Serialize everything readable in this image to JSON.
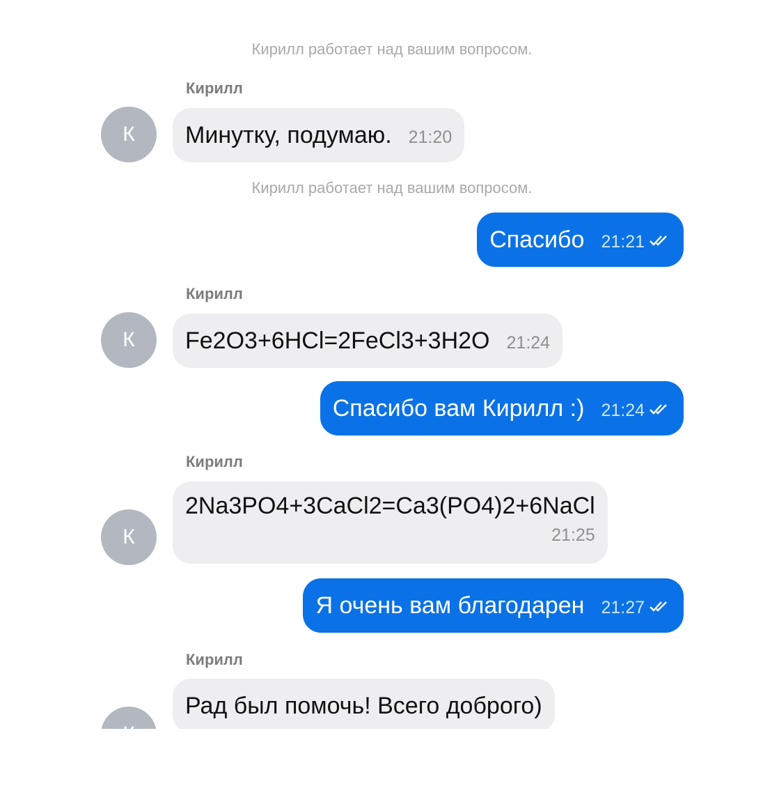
{
  "colors": {
    "outgoing_bubble": "#0a72e6",
    "incoming_bubble": "#eeeef1",
    "avatar": "#b3b8c0",
    "status_text": "#a9a9a9"
  },
  "status_1": "Кирилл работает над вашим вопросом.",
  "status_2": "Кирилл работает над вашим вопросом.",
  "messages": [
    {
      "sender": "Кирилл",
      "avatar": "К",
      "text": "Минутку, подумаю.",
      "time": "21:20",
      "direction": "in"
    },
    {
      "text": "Спасибо",
      "time": "21:21",
      "direction": "out",
      "read_icon": "double-check-icon"
    },
    {
      "sender": "Кирилл",
      "avatar": "К",
      "text": "Fe2O3+6HCl=2FeCl3+3H2O",
      "time": "21:24",
      "direction": "in"
    },
    {
      "text": "Спасибо вам Кирилл :)",
      "time": "21:24",
      "direction": "out",
      "read_icon": "double-check-icon"
    },
    {
      "sender": "Кирилл",
      "avatar": "К",
      "text": "2Na3PO4+3CaCl2=Ca3(PO4)2+6NaCl",
      "time": "21:25",
      "direction": "in"
    },
    {
      "text": "Я очень вам благодарен",
      "time": "21:27",
      "direction": "out",
      "read_icon": "double-check-icon"
    },
    {
      "sender": "Кирилл",
      "avatar": "К",
      "text": "Рад был помочь! Всего доброго)",
      "direction": "in"
    }
  ]
}
